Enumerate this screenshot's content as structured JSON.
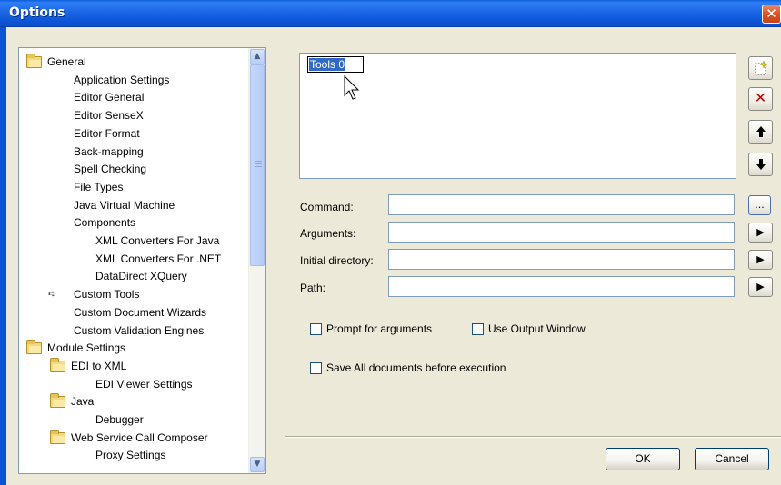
{
  "window": {
    "title": "Options",
    "close_glyph": "✕"
  },
  "tree": {
    "items": [
      {
        "label": "General",
        "icon": "folder-icon",
        "level": 0
      },
      {
        "label": "Application Settings",
        "level": 1
      },
      {
        "label": "Editor General",
        "level": 1
      },
      {
        "label": "Editor SenseX",
        "level": 1
      },
      {
        "label": "Editor Format",
        "level": 1
      },
      {
        "label": "Back-mapping",
        "level": 1
      },
      {
        "label": "Spell Checking",
        "level": 1
      },
      {
        "label": "File Types",
        "level": 1
      },
      {
        "label": "Java Virtual Machine",
        "level": 1
      },
      {
        "label": "Components",
        "level": 1
      },
      {
        "label": "XML Converters For Java",
        "level": 2
      },
      {
        "label": "XML Converters For .NET",
        "level": 2
      },
      {
        "label": "DataDirect XQuery",
        "level": 2
      },
      {
        "label": "Custom Tools",
        "level": 1,
        "selected": true
      },
      {
        "label": "Custom Document Wizards",
        "level": 1
      },
      {
        "label": "Custom Validation Engines",
        "level": 1
      },
      {
        "label": "Module Settings",
        "icon": "folder-icon",
        "level": 0
      },
      {
        "label": "EDI to XML",
        "icon": "folder-icon",
        "level": 1
      },
      {
        "label": "EDI Viewer Settings",
        "level": 2
      },
      {
        "label": "Java",
        "icon": "folder-icon",
        "level": 1
      },
      {
        "label": "Debugger",
        "level": 2
      },
      {
        "label": "Web Service Call Composer",
        "icon": "folder-icon",
        "level": 1
      },
      {
        "label": "Proxy Settings",
        "level": 2
      }
    ]
  },
  "tools_list": {
    "editing_value": "Tools 0"
  },
  "side_buttons": {
    "new_icon": "new-item-icon",
    "delete_glyph": "✕",
    "up_glyph": "🡅",
    "down_glyph": "🡇"
  },
  "form": {
    "command_label": "Command:",
    "command_value": "",
    "browse_label": "...",
    "arguments_label": "Arguments:",
    "arguments_value": "",
    "initial_directory_label": "Initial directory:",
    "initial_directory_value": "",
    "path_label": "Path:",
    "path_value": "",
    "arrow_glyph": "▶"
  },
  "options": {
    "prompt_for_arguments": "Prompt for arguments",
    "use_output_window": "Use Output Window",
    "save_all_documents": "Save All documents before execution"
  },
  "footer": {
    "ok_label": "OK",
    "cancel_label": "Cancel"
  }
}
